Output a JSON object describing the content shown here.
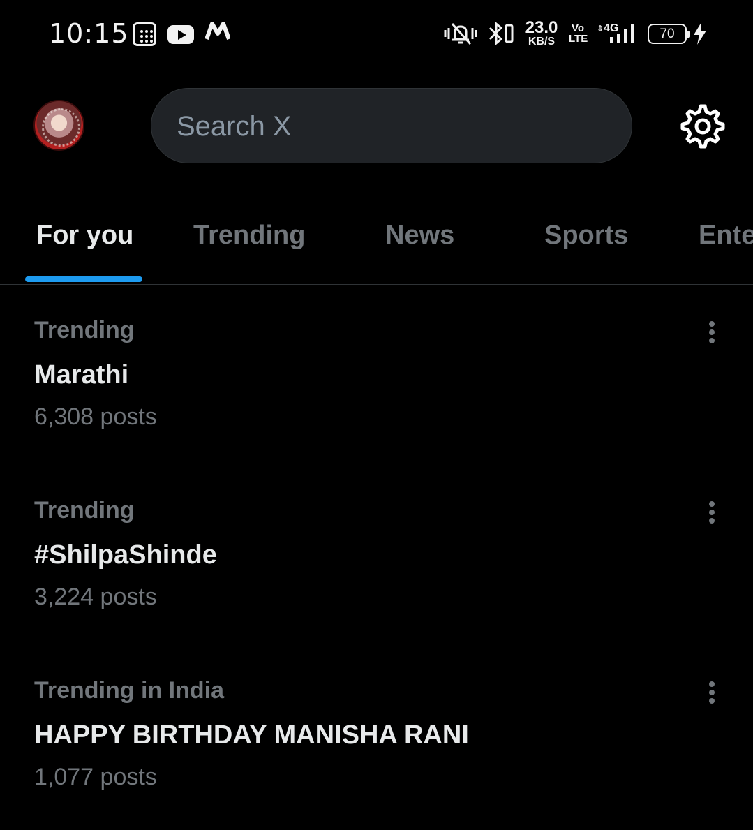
{
  "status_bar": {
    "time": "10:15",
    "net_speed_value": "23.0",
    "net_speed_unit": "KB/S",
    "volte_top": "Vo",
    "volte_bottom": "LTE",
    "network": "4G",
    "battery_level": "70",
    "battery_fraction": 0.7,
    "icons": [
      "calculator-icon",
      "youtube-icon",
      "myntra-icon",
      "mute-vibrate-icon",
      "bluetooth-icon",
      "signal-icon",
      "battery-icon",
      "charging-icon"
    ]
  },
  "header": {
    "search_placeholder": "Search X",
    "settings_icon": "gear-icon",
    "avatar_icon": "profile-avatar"
  },
  "tabs": [
    {
      "label": "For you",
      "active": true
    },
    {
      "label": "Trending",
      "active": false
    },
    {
      "label": "News",
      "active": false
    },
    {
      "label": "Sports",
      "active": false
    },
    {
      "label": "Ente",
      "active": false
    }
  ],
  "trends": [
    {
      "context": "Trending",
      "name": "Marathi",
      "posts": "6,308 posts"
    },
    {
      "context": "Trending",
      "name": "#ShilpaShinde",
      "posts": "3,224 posts"
    },
    {
      "context": "Trending in India",
      "name": "HAPPY BIRTHDAY MANISHA RANI",
      "posts": "1,077 posts"
    }
  ],
  "colors": {
    "background": "#000000",
    "accent": "#1d9bf0",
    "primary_text": "#e7e9ea",
    "secondary_text": "#71767b",
    "search_bg": "#202327"
  }
}
